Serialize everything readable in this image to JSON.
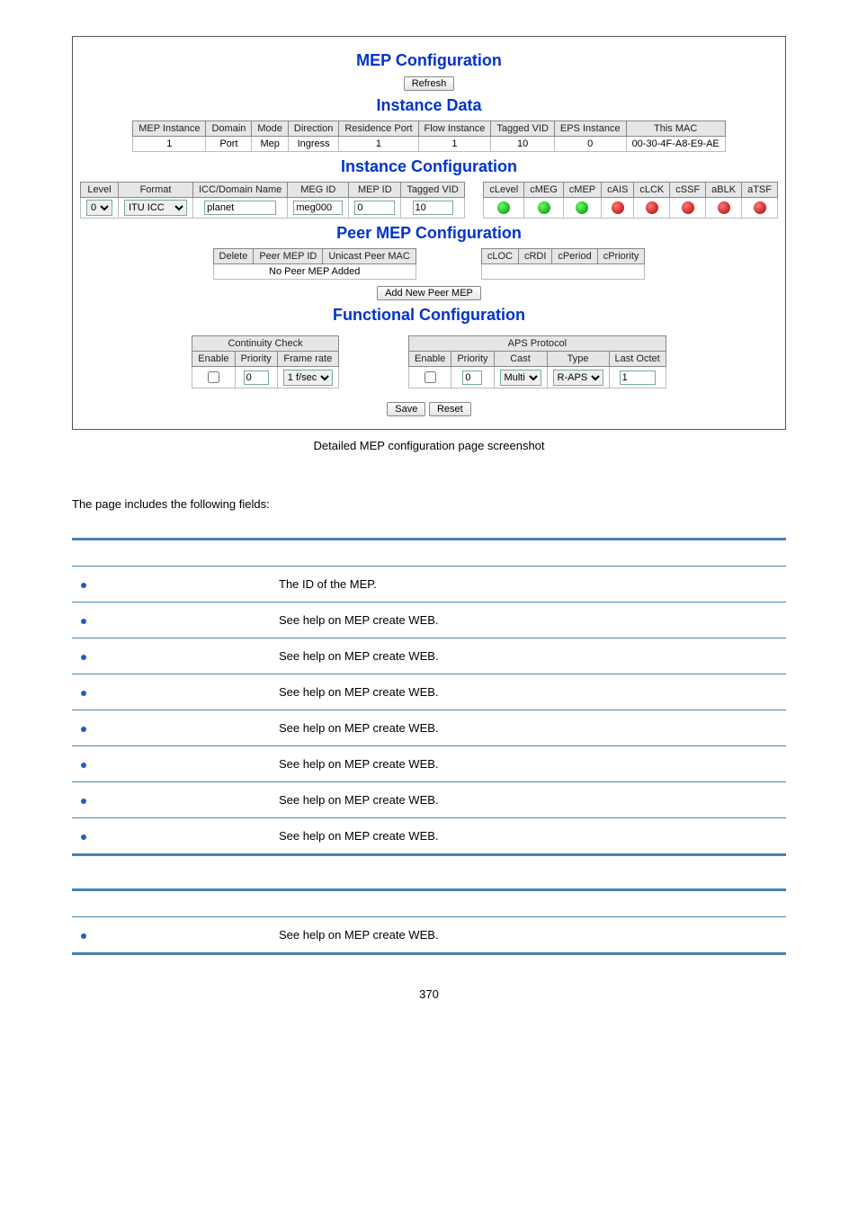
{
  "screenshot": {
    "mep_config_title": "MEP Configuration",
    "refresh_btn": "Refresh",
    "instance_data": {
      "title": "Instance Data",
      "headers": [
        "MEP Instance",
        "Domain",
        "Mode",
        "Direction",
        "Residence Port",
        "Flow Instance",
        "Tagged VID",
        "EPS Instance",
        "This MAC"
      ],
      "row": [
        "1",
        "Port",
        "Mep",
        "Ingress",
        "1",
        "1",
        "10",
        "0",
        "00-30-4F-A8-E9-AE"
      ]
    },
    "instance_config": {
      "title": "Instance Configuration",
      "headers_left": [
        "Level",
        "Format",
        "ICC/Domain Name",
        "MEG ID",
        "MEP ID",
        "Tagged VID"
      ],
      "headers_right": [
        "cLevel",
        "cMEG",
        "cMEP",
        "cAIS",
        "cLCK",
        "cSSF",
        "aBLK",
        "aTSF"
      ],
      "level_options": [
        "0"
      ],
      "level_value": "0",
      "format_options": [
        "ITU ICC"
      ],
      "format_value": "ITU ICC",
      "icc_value": "planet",
      "megid_value": "meg000",
      "mepid_value": "0",
      "tagged_vid_value": "10",
      "dots": [
        "green",
        "green",
        "green",
        "red",
        "red",
        "red",
        "red",
        "red"
      ]
    },
    "peer_mep": {
      "title": "Peer MEP Configuration",
      "headers_left": [
        "Delete",
        "Peer MEP ID",
        "Unicast Peer MAC"
      ],
      "headers_right": [
        "cLOC",
        "cRDI",
        "cPeriod",
        "cPriority"
      ],
      "empty": "No Peer MEP Added",
      "add_btn": "Add New Peer MEP"
    },
    "functional": {
      "title": "Functional Configuration",
      "cc_title": "Continuity Check",
      "cc_headers": [
        "Enable",
        "Priority",
        "Frame rate"
      ],
      "cc_priority": "0",
      "cc_frame_rate": "1 f/sec",
      "aps_title": "APS Protocol",
      "aps_headers": [
        "Enable",
        "Priority",
        "Cast",
        "Type",
        "Last Octet"
      ],
      "aps_priority": "0",
      "aps_cast": "Multi",
      "aps_type": "R-APS",
      "aps_last_octet": "1"
    },
    "save_btn": "Save",
    "reset_btn": "Reset"
  },
  "figcaption": "Detailed MEP configuration page screenshot",
  "intro_text": "The page includes the following fields:",
  "table1": {
    "rows": [
      "The ID of the MEP.",
      "See help on MEP create WEB.",
      "See help on MEP create WEB.",
      "See help on MEP create WEB.",
      "See help on MEP create WEB.",
      "See help on MEP create WEB.",
      "See help on MEP create WEB.",
      "See help on MEP create WEB."
    ]
  },
  "table2": {
    "rows": [
      "See help on MEP create WEB."
    ]
  },
  "page_number": "370"
}
